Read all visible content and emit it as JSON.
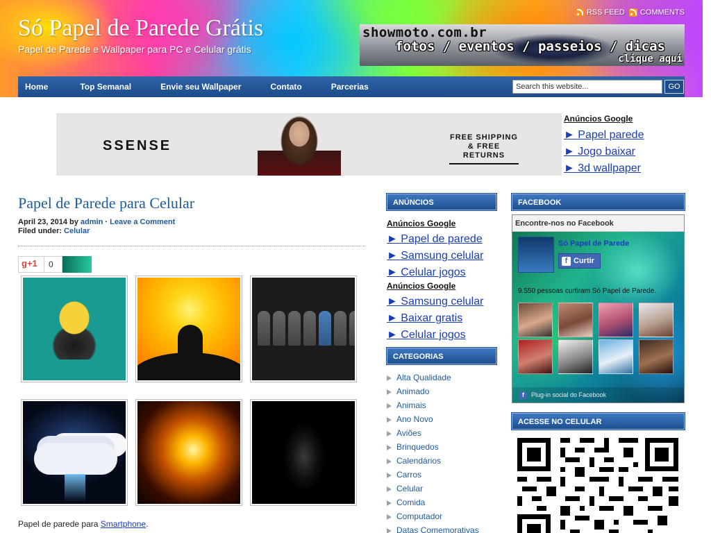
{
  "site": {
    "title": "Só Papel de Parede Grátis",
    "description": "Papel de Parede e Wallpaper para PC e Celular grátis",
    "rss_feed": "RSS FEED",
    "comments": "COMMENTS"
  },
  "header_banner": {
    "site": "showmoto.com.br",
    "tagline": "fotos / eventos / passeios / dicas",
    "cta": "clique aqui"
  },
  "nav": {
    "items": [
      "Home",
      "Top Semanal",
      "Envie seu Wallpaper",
      "Contato",
      "Parcerias"
    ],
    "search_placeholder": "Search this website...",
    "search_value": "Search this website...",
    "search_button": "GO"
  },
  "top_ad": {
    "brand": "SSENSE",
    "shipping_line1": "FREE SHIPPING",
    "shipping_line2": "& FREE RETURNS"
  },
  "top_ads_links": {
    "heading": "Anúncios Google",
    "links": [
      "► Papel parede",
      "► Jogo baixar",
      "► 3d wallpaper"
    ]
  },
  "post": {
    "title": "Papel de Parede para Celular",
    "date": "April 23, 2014",
    "by": "by",
    "author": "admin",
    "separator": "·",
    "comment_link": "Leave a Comment",
    "filed_under": "Filed under:",
    "category": "Celular",
    "gplus_label": "g+1",
    "gplus_count": "0",
    "caption_prefix": "Papel de parede para ",
    "caption_link": "Smartphone",
    "caption_suffix": "."
  },
  "sidebar_mid": {
    "ads_title": "ANÚNCIOS",
    "ads_heading_1": "Anúncios Google",
    "ads_links_1": [
      "► Papel de parede",
      "► Samsung celular",
      "► Celular jogos"
    ],
    "ads_heading_2": "Anúncios Google",
    "ads_links_2": [
      "► Samsung celular",
      "► Baixar gratis",
      "► Celular jogos"
    ],
    "categories_title": "CATEGORIAS",
    "categories": [
      "Alta Qualidade",
      "Animado",
      "Animais",
      "Ano Novo",
      "Aviões",
      "Brinquedos",
      "Calendários",
      "Carros",
      "Celular",
      "Comida",
      "Computador",
      "Datas Comemorativas"
    ]
  },
  "sidebar_right": {
    "facebook_title": "FACEBOOK",
    "fb_header": "Encontre-nos no Facebook",
    "fb_page_name": "Só Papel de Parede",
    "fb_like": "Curtir",
    "fb_count": "9.550 pessoas curtiram Só Papel de Parede.",
    "fb_footer": "Plug-in social do Facebook",
    "mobile_title": "ACESSE NO CELULAR"
  },
  "colors": {
    "nav_blue": "#1c4b8a",
    "link_blue": "#1f5a9a",
    "ad_link_blue": "#1a3db8"
  }
}
